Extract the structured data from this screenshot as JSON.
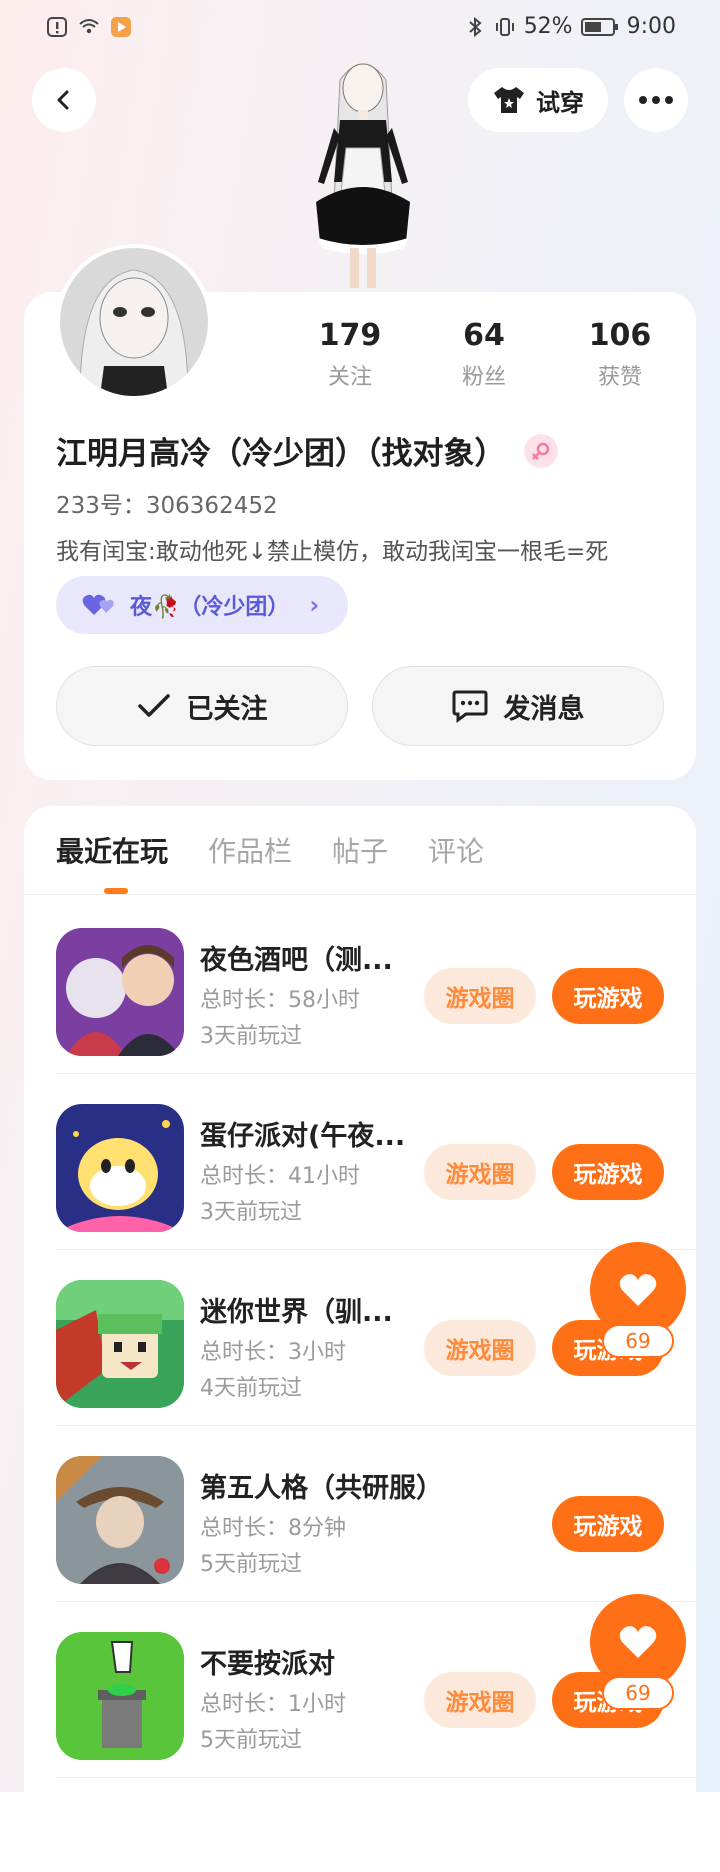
{
  "status_bar": {
    "battery": "52%",
    "time": "9:00"
  },
  "header": {
    "try_on_label": "试穿"
  },
  "profile": {
    "stats": [
      {
        "value": "179",
        "label": "关注"
      },
      {
        "value": "64",
        "label": "粉丝"
      },
      {
        "value": "106",
        "label": "获赞"
      }
    ],
    "name": "江明月高冷（冷少团）（找对象）",
    "uid": "233号：306362452",
    "bio": "我有闰宝:敢动他死↓禁止模仿，敢动我闰宝一根毛=死",
    "group": "夜🥀（冷少团）",
    "follow_label": "已关注",
    "message_label": "发消息"
  },
  "tabs": [
    {
      "label": "最近在玩",
      "active": true
    },
    {
      "label": "作品栏",
      "active": false
    },
    {
      "label": "帖子",
      "active": false
    },
    {
      "label": "评论",
      "active": false
    }
  ],
  "games": [
    {
      "name": "夜色酒吧（测...",
      "duration": "总时长：58小时",
      "last": "3天前玩过",
      "circle": "游戏圈",
      "play": "玩游戏"
    },
    {
      "name": "蛋仔派对(午夜...",
      "duration": "总时长：41小时",
      "last": "3天前玩过",
      "circle": "游戏圈",
      "play": "玩游戏"
    },
    {
      "name": "迷你世界（驯...",
      "duration": "总时长：3小时",
      "last": "4天前玩过",
      "circle": "游戏圈",
      "play": "玩游戏"
    },
    {
      "name": "第五人格（共研服）",
      "duration": "总时长：8分钟",
      "last": "5天前玩过",
      "circle": "",
      "play": "玩游戏"
    },
    {
      "name": "不要按派对",
      "duration": "总时长：1小时",
      "last": "5天前玩过",
      "circle": "游戏圈",
      "play": "玩游戏"
    }
  ],
  "likes": [
    {
      "count": "69"
    },
    {
      "count": "69"
    }
  ],
  "colors": {
    "accent": "#ff6f16",
    "accent_light": "#fde9dc",
    "chip": "#e9e7fb",
    "chip_text": "#5a59d8"
  }
}
